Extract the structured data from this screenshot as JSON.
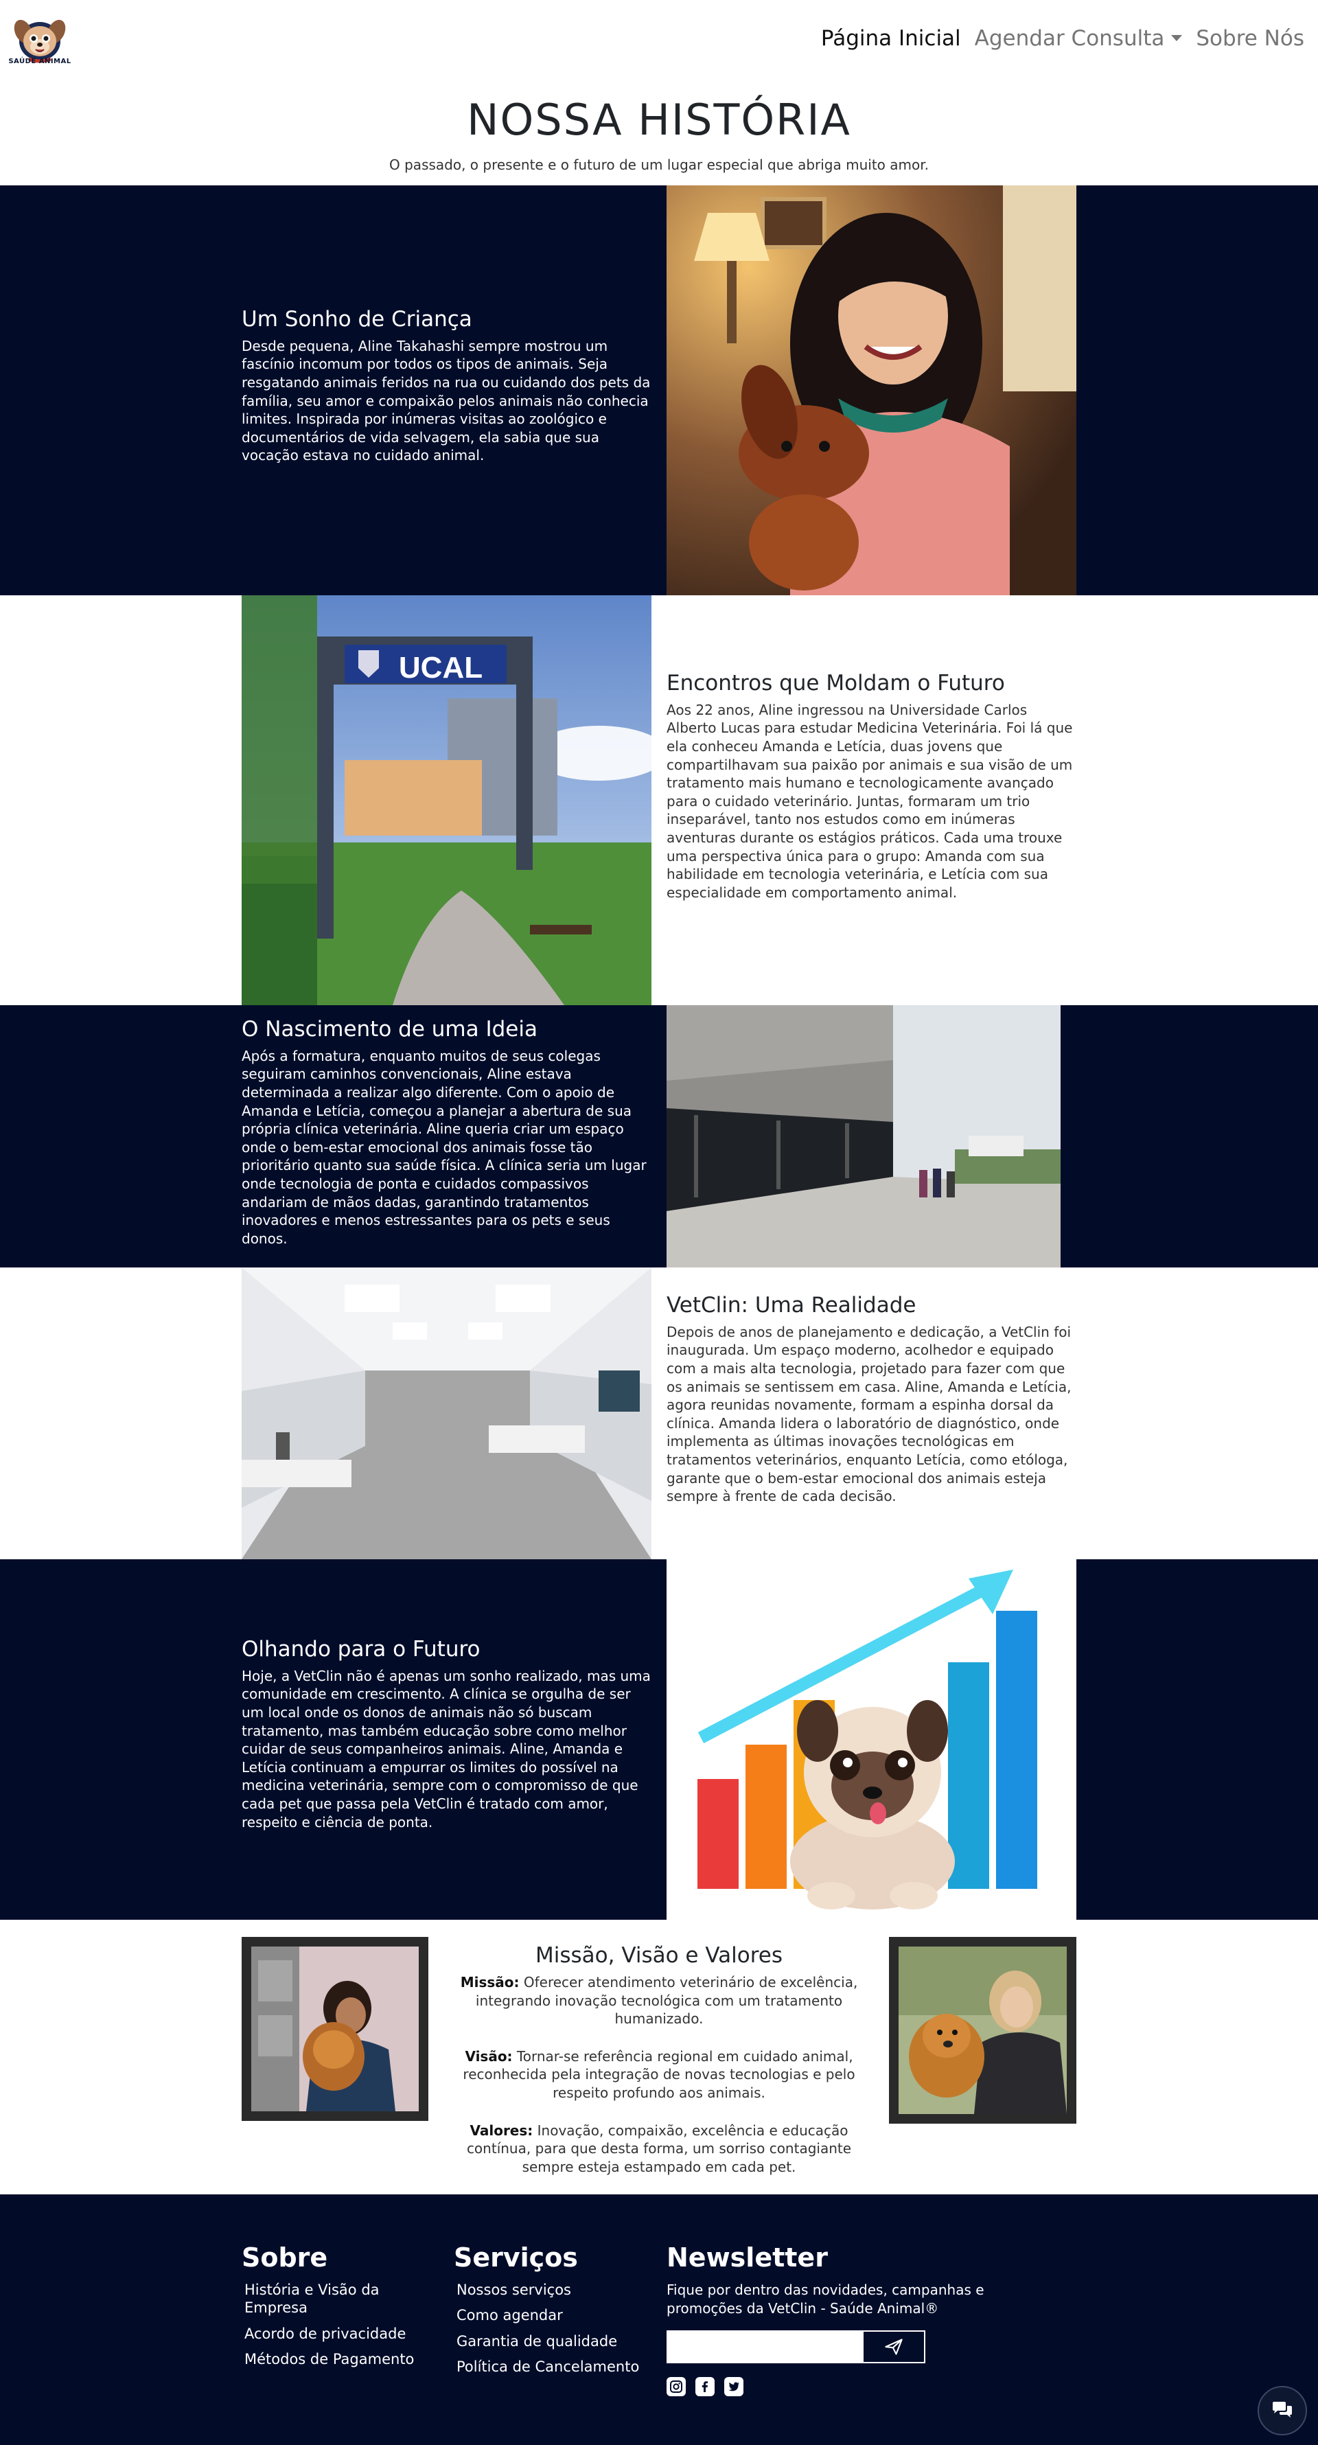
{
  "nav": {
    "logo_text": "SAÚDE ANIMAL",
    "items": [
      {
        "label": "Página Inicial",
        "active": true
      },
      {
        "label": "Agendar Consulta",
        "dropdown": true
      },
      {
        "label": "Sobre Nós"
      }
    ]
  },
  "hero": {
    "title": "NOSSA HISTÓRIA",
    "subtitle": "O passado, o presente e o futuro de um lugar especial que abriga muito amor."
  },
  "sections": [
    {
      "title": "Um Sonho de Criança",
      "text": "Desde pequena, Aline Takahashi sempre mostrou um fascínio incomum por todos os tipos de animais. Seja resgatando animais feridos na rua ou cuidando dos pets da família, seu amor e compaixão pelos animais não conhecia limites. Inspirada por inúmeras visitas ao zoológico e documentários de vida selvagem, ela sabia que sua vocação estava no cuidado animal."
    },
    {
      "title": "Encontros que Moldam o Futuro",
      "text": "Aos 22 anos, Aline ingressou na Universidade Carlos Alberto Lucas para estudar Medicina Veterinária. Foi lá que ela conheceu Amanda e Letícia, duas jovens que compartilhavam sua paixão por animais e sua visão de um tratamento mais humano e tecnologicamente avançado para o cuidado veterinário. Juntas, formaram um trio inseparável, tanto nos estudos como em inúmeras aventuras durante os estágios práticos. Cada uma trouxe uma perspectiva única para o grupo: Amanda com sua habilidade em tecnologia veterinária, e Letícia com sua especialidade em comportamento animal.",
      "sign_text": "UCAL"
    },
    {
      "title": "O Nascimento de uma Ideia",
      "text": "Após a formatura, enquanto muitos de seus colegas seguiram caminhos convencionais, Aline estava determinada a realizar algo diferente. Com o apoio de Amanda e Letícia, começou a planejar a abertura de sua própria clínica veterinária. Aline queria criar um espaço onde o bem-estar emocional dos animais fosse tão prioritário quanto sua saúde física. A clínica seria um lugar onde tecnologia de ponta e cuidados compassivos andariam de mãos dadas, garantindo tratamentos inovadores e menos estressantes para os pets e seus donos."
    },
    {
      "title": "VetClin: Uma Realidade",
      "text": "Depois de anos de planejamento e dedicação, a VetClin foi inaugurada. Um espaço moderno, acolhedor e equipado com a mais alta tecnologia, projetado para fazer com que os animais se sentissem em casa. Aline, Amanda e Letícia, agora reunidas novamente, formam a espinha dorsal da clínica. Amanda lidera o laboratório de diagnóstico, onde implementa as últimas inovações tecnológicas em tratamentos veterinários, enquanto Letícia, como etóloga, garante que o bem-estar emocional dos animais esteja sempre à frente de cada decisão."
    },
    {
      "title": "Olhando para o Futuro",
      "text": "Hoje, a VetClin não é apenas um sonho realizado, mas uma comunidade em crescimento. A clínica se orgulha de ser um local onde os donos de animais não só buscam tratamento, mas também educação sobre como melhor cuidar de seus companheiros animais. Aline, Amanda e Letícia continuam a empurrar os limites do possível na medicina veterinária, sempre com o compromisso de que cada pet que passa pela VetClin é tratado com amor, respeito e ciência de ponta."
    }
  ],
  "mvv": {
    "title": "Missão, Visão e Valores",
    "items": [
      {
        "label": "Missão:",
        "text": " Oferecer atendimento veterinário de excelência, integrando inovação tecnológica com um tratamento humanizado."
      },
      {
        "label": "Visão:",
        "text": " Tornar-se referência regional em cuidado animal, reconhecida pela integração de novas tecnologias e pelo respeito profundo aos animais."
      },
      {
        "label": "Valores:",
        "text": " Inovação, compaixão, excelência e educação contínua, para que desta forma, um sorriso contagiante sempre esteja estampado em cada pet."
      }
    ]
  },
  "footer": {
    "sobre": {
      "title": "Sobre",
      "links": [
        "História e Visão da Empresa",
        "Acordo de privacidade",
        "Métodos de Pagamento"
      ]
    },
    "servicos": {
      "title": "Serviços",
      "links": [
        "Nossos serviços",
        "Como agendar",
        "Garantia de qualidade",
        "Política de Cancelamento"
      ]
    },
    "newsletter": {
      "title": "Newsletter",
      "text": "Fique por dentro das novidades, campanhas e promoções da VetClin - Saúde Animal®",
      "input_placeholder": ""
    }
  },
  "colors": {
    "navy": "#020c29",
    "chart_cyan": "#4fd6f2"
  }
}
